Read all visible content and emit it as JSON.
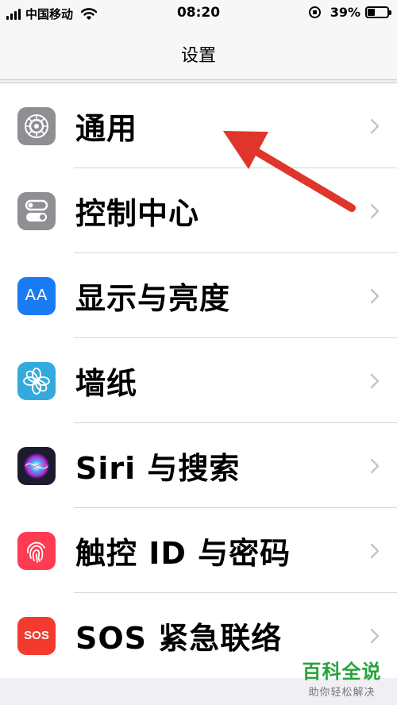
{
  "status_bar": {
    "carrier": "中国移动",
    "time": "08:20",
    "battery_percent_text": "39%",
    "battery_level": 0.39
  },
  "nav": {
    "title": "设置"
  },
  "settings_items": [
    {
      "label": "通用",
      "icon": "gear-icon",
      "color": "#8e8e93"
    },
    {
      "label": "控制中心",
      "icon": "toggle-switches-icon",
      "color": "#8e8e93"
    },
    {
      "label": "显示与亮度",
      "icon": "text-size-icon",
      "color": "#1a7cf5"
    },
    {
      "label": "墙纸",
      "icon": "flower-icon",
      "color": "#34aadc"
    },
    {
      "label": "Siri 与搜索",
      "icon": "siri-icon",
      "color": "#1c1c2e"
    },
    {
      "label": "触控 ID 与密码",
      "icon": "fingerprint-icon",
      "color": "#ff3b52"
    },
    {
      "label": "SOS 紧急联络",
      "icon": "sos-icon",
      "color": "#f23a2f"
    }
  ],
  "icons": {
    "sos_text": "SOS",
    "display_text": "AA"
  },
  "annotation": {
    "arrow_color": "#e0352b",
    "target": "通用"
  },
  "watermark": {
    "title": "百科全说",
    "subtitle": "助你轻松解决"
  }
}
